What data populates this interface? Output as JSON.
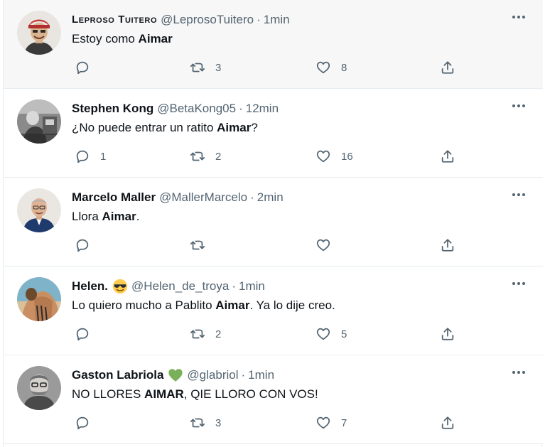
{
  "tweets": [
    {
      "display_name": "Leproso Tuitero",
      "handle": "@LeprosoTuitero",
      "separator": "·",
      "time": "1min",
      "text_before": "Estoy como ",
      "text_bold": "Aimar",
      "text_after": "",
      "reply_count": "",
      "retweet_count": "3",
      "like_count": "8",
      "highlighted": true
    },
    {
      "display_name": "Stephen Kong",
      "handle": "@BetaKong05",
      "separator": "·",
      "time": "12min",
      "text_before": "¿No puede entrar un ratito ",
      "text_bold": "Aimar",
      "text_after": "?",
      "reply_count": "1",
      "retweet_count": "2",
      "like_count": "16",
      "highlighted": false
    },
    {
      "display_name": "Marcelo Maller",
      "handle": "@MallerMarcelo",
      "separator": "·",
      "time": "2min",
      "text_before": "Llora ",
      "text_bold": "Aimar",
      "text_after": ".",
      "reply_count": "",
      "retweet_count": "",
      "like_count": "",
      "highlighted": false
    },
    {
      "display_name": "Helen.",
      "display_emoji": "smiling-face-with-sunglasses-emoji",
      "handle": "@Helen_de_troya",
      "separator": "·",
      "time": "1min",
      "text_before": "Lo quiero mucho a Pablito ",
      "text_bold": "Aimar",
      "text_after": ". Ya lo dije creo.",
      "reply_count": "",
      "retweet_count": "2",
      "like_count": "5",
      "highlighted": false
    },
    {
      "display_name": "Gaston Labriola",
      "display_emoji": "green-heart-emoji",
      "handle": "@glabriol",
      "separator": "·",
      "time": "1min",
      "text_before": "NO LLORES ",
      "text_bold": "AIMAR",
      "text_after": ", QIE LLORO CON VOS!",
      "reply_count": "",
      "retweet_count": "3",
      "like_count": "7",
      "highlighted": false
    }
  ],
  "icons": {
    "reply": "reply-icon",
    "retweet": "retweet-icon",
    "like": "like-icon",
    "share": "share-icon",
    "more": "more-icon"
  },
  "colors": {
    "text": "#0f1419",
    "secondary": "#536471",
    "highlight_bg": "#f7f7f7",
    "divider": "#e6ecf0",
    "green_heart": "#78b159",
    "emoji_yellow": "#ffcc4d"
  }
}
